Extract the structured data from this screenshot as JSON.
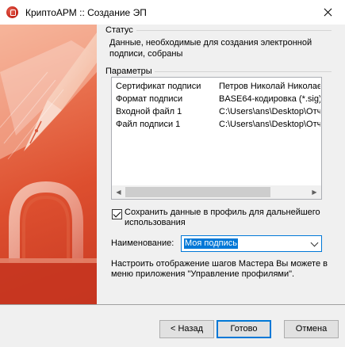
{
  "window": {
    "title": "КриптоАРМ :: Создание ЭП"
  },
  "status": {
    "heading": "Статус",
    "text": "Данные, необходимые для создания электронной подписи, собраны"
  },
  "params": {
    "heading": "Параметры",
    "rows": [
      {
        "key": "Сертификат подписи",
        "value": "Петров Николай Николаевич"
      },
      {
        "key": "Формат подписи",
        "value": "BASE64-кодировка (*.sig)"
      },
      {
        "key": "Входной файл 1",
        "value": "C:\\Users\\ans\\Desktop\\Отчет"
      },
      {
        "key": "Файл подписи 1",
        "value": "C:\\Users\\ans\\Desktop\\Отчет"
      }
    ]
  },
  "save_profile": {
    "checked": true,
    "label": "Сохранить данные в профиль для дальнейшего использования"
  },
  "name_field": {
    "label": "Наименование:",
    "value": "Моя подпись"
  },
  "hint": "Настроить отображение шагов Мастера Вы можете в меню приложения \"Управление профилями\".",
  "buttons": {
    "back": "< Назад",
    "finish": "Готово",
    "cancel": "Отмена"
  },
  "colors": {
    "accent": "#0078d7",
    "brand": "#d8412a"
  },
  "icons": {
    "app": "cryptoarm-lock-icon",
    "close": "close-icon",
    "combo": "chevron-down-icon"
  }
}
